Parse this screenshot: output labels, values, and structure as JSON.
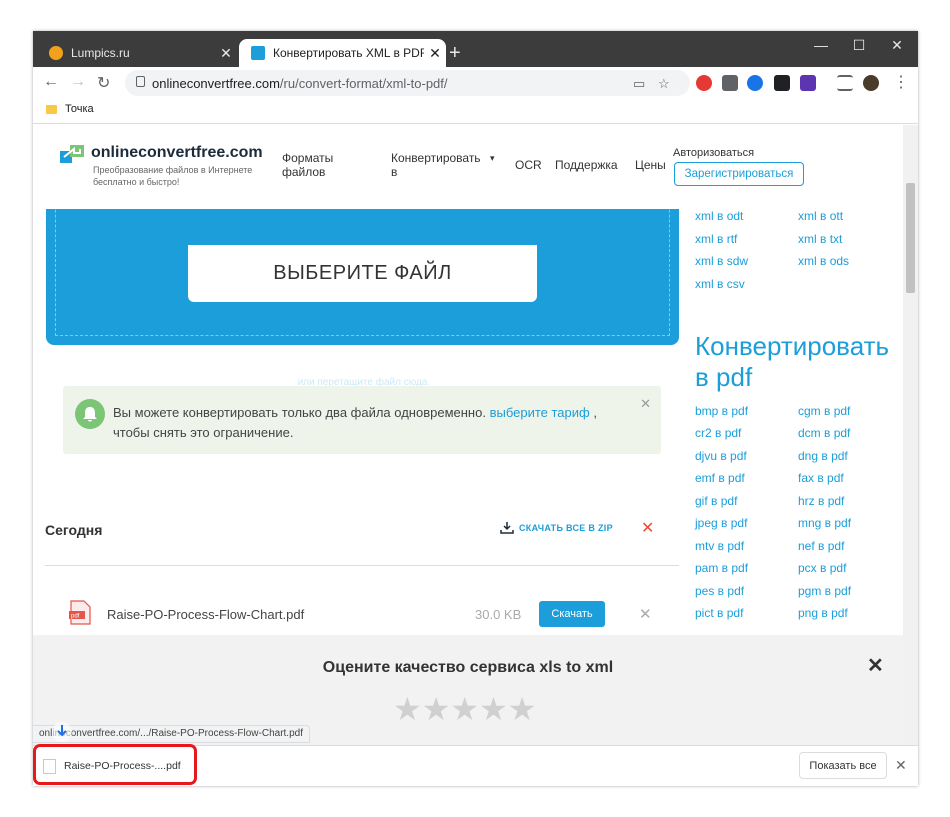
{
  "browser": {
    "tabs": [
      {
        "title": "Lumpics.ru",
        "active": false
      },
      {
        "title": "Конвертировать XML в PDF онлайн",
        "active": true
      }
    ],
    "new_tab_icon": "plus-icon",
    "url_domain": "onlineconvertfree.com",
    "url_path": "/ru/convert-format/xml-to-pdf/",
    "bookmark": "Точка",
    "window_controls": [
      "minimize-icon",
      "maximize-icon",
      "close-icon"
    ]
  },
  "site": {
    "logo_text": "onlineconvertfree.com",
    "tagline": "Преобразование файлов в Интернете бесплатно и быстро!",
    "nav": {
      "formats": "Форматы файлов",
      "convert": "Конвертировать в",
      "ocr": "OCR",
      "support": "Поддержка",
      "prices": "Цены"
    },
    "login": "Авторизоваться",
    "register": "Зарегистрироваться"
  },
  "upload": {
    "choose_file": "ВЫБЕРИТЕ ФАЙЛ",
    "drop_hint": "или перетащите файл сюда"
  },
  "notice": {
    "text": "Вы можете конвертировать только два файла одновременно.",
    "link": "выберите тариф",
    "tail": ", чтобы снять это ограничение."
  },
  "files": {
    "section_title": "Сегодня",
    "download_all": "СКАЧАТЬ ВСЕ В ZIP",
    "items": [
      {
        "name": "Raise-PO-Process-Flow-Chart.pdf",
        "size": "30.0 KB",
        "button": "Скачать"
      }
    ]
  },
  "sidebar": {
    "xml_links": [
      [
        "xml в odt",
        "xml в ott"
      ],
      [
        "xml в rtf",
        "xml в txt"
      ],
      [
        "xml в sdw",
        "xml в ods"
      ],
      [
        "xml в csv",
        ""
      ]
    ],
    "heading": "Конвертировать в pdf",
    "pdf_links": [
      [
        "bmp в pdf",
        "cgm в pdf"
      ],
      [
        "cr2 в pdf",
        "dcm в pdf"
      ],
      [
        "djvu в pdf",
        "dng в pdf"
      ],
      [
        "emf в pdf",
        "fax в pdf"
      ],
      [
        "gif в pdf",
        "hrz в pdf"
      ],
      [
        "jpeg в pdf",
        "mng в pdf"
      ],
      [
        "mtv в pdf",
        "nef в pdf"
      ],
      [
        "pam в pdf",
        "pcx в pdf"
      ],
      [
        "pes в pdf",
        "pgm в pdf"
      ],
      [
        "pict в pdf",
        "png в pdf"
      ]
    ]
  },
  "rating": {
    "title": "Оцените качество сервиса xls to xml",
    "stars": 5,
    "value": 0
  },
  "status_url": "onlineconvertfree.com/.../Raise-PO-Process-Flow-Chart.pdf",
  "shelf": {
    "file": "Raise-PO-Process-....pdf",
    "show_all": "Показать все"
  },
  "colors": {
    "accent": "#1b9ed9",
    "highlight": "#e61a1a"
  }
}
